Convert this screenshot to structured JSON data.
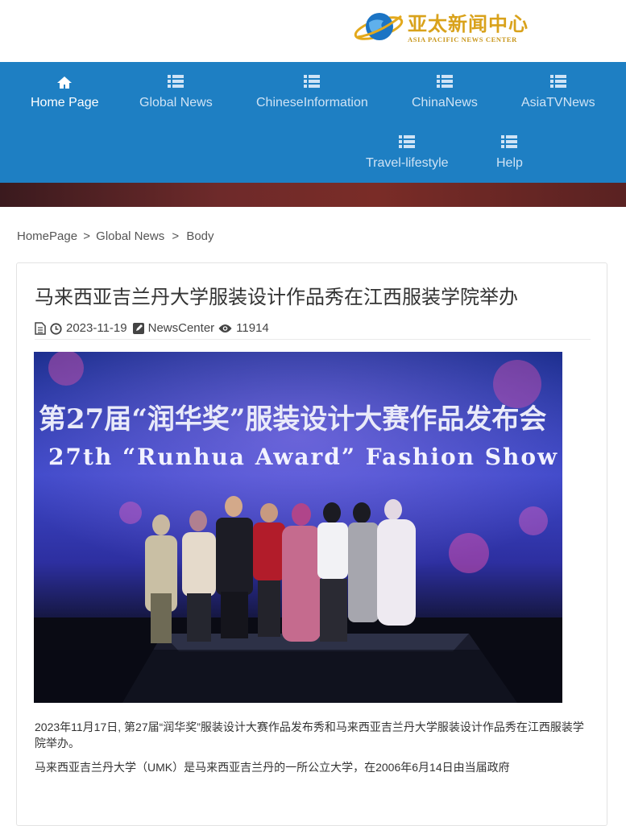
{
  "logo": {
    "cn": "亚太新闻中心",
    "en": "ASIA PACIFIC NEWS CENTER"
  },
  "nav": {
    "items": [
      {
        "label": "Home Page",
        "icon": "home-icon"
      },
      {
        "label": "Global News",
        "icon": "list-icon"
      },
      {
        "label": "ChineseInformation",
        "icon": "list-icon"
      },
      {
        "label": "ChinaNews",
        "icon": "list-icon"
      },
      {
        "label": "AsiaTVNews",
        "icon": "list-icon"
      },
      {
        "label": "Travel-lifestyle",
        "icon": "list-icon"
      },
      {
        "label": "Help",
        "icon": "list-icon"
      }
    ]
  },
  "breadcrumb": {
    "home": "HomePage",
    "sep1": ">",
    "section": "Global News",
    "sep2": ">",
    "current": "Body"
  },
  "article": {
    "title": "马来西亚吉兰丹大学服装设计作品秀在江西服装学院举办",
    "date": "2023-11-19",
    "author": "NewsCenter",
    "views": "11914",
    "image_text_cn": "第27届“润华奖”服装设计大赛作品发布会",
    "image_text_en": "27th “Runhua Award” Fashion Show",
    "para1": "2023年11月17日, 第27届“润华奖”服装设计大赛作品发布秀和马来西亚吉兰丹大学服装设计作品秀在江西服装学院举办。",
    "para2": "马来西亚吉兰丹大学（UMK）是马来西亚吉兰丹的一所公立大学，在2006年6月14日由当届政府"
  },
  "colors": {
    "nav_bg": "#1e7fc3",
    "nav_text": "#cfe3f5",
    "nav_active": "#ffffff",
    "logo_gold": "#d9a21b"
  }
}
